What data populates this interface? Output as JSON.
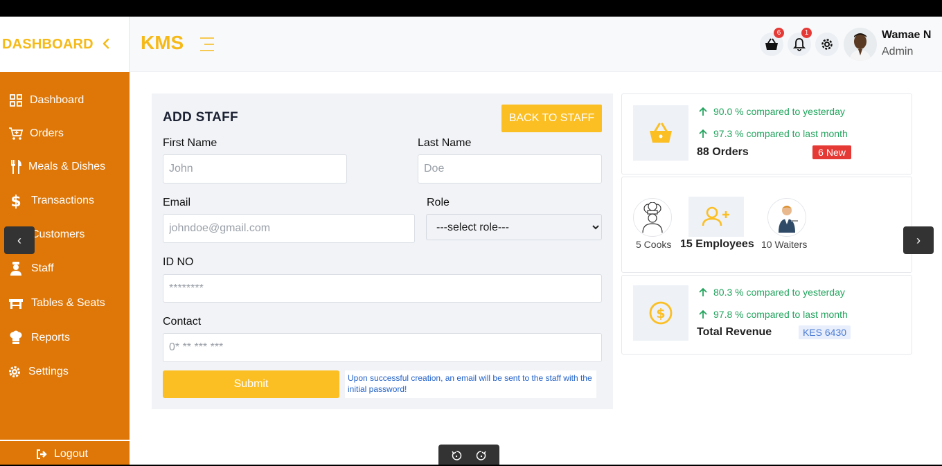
{
  "brand": {
    "title": "DASHBOARD"
  },
  "header": {
    "app_name": "KMS",
    "cart_badge": "6",
    "notif_badge": "1",
    "user_name": "Wamae N",
    "user_role": "Admin"
  },
  "sidebar": {
    "items": [
      {
        "label": "Dashboard",
        "icon": "grid-icon"
      },
      {
        "label": "Orders",
        "icon": "cart-icon"
      },
      {
        "label": "Meals & Dishes",
        "icon": "utensils-icon"
      },
      {
        "label": "Transactions",
        "icon": "dollar-icon"
      },
      {
        "label": "Customers",
        "icon": "users-icon"
      },
      {
        "label": "Staff",
        "icon": "staff-icon"
      },
      {
        "label": "Tables & Seats",
        "icon": "table-icon"
      },
      {
        "label": "Reports",
        "icon": "chef-hat-icon"
      },
      {
        "label": "Settings",
        "icon": "gear-icon"
      }
    ],
    "logout": "Logout"
  },
  "form": {
    "title": "ADD STAFF",
    "back_label": "BACK TO STAFF",
    "first_name_label": "First Name",
    "first_name_placeholder": "John",
    "last_name_label": "Last Name",
    "last_name_placeholder": "Doe",
    "email_label": "Email",
    "email_placeholder": "johndoe@gmail.com",
    "role_label": "Role",
    "role_selected": "---select role---",
    "id_label": "ID NO",
    "id_placeholder": "********",
    "contact_label": "Contact",
    "contact_placeholder": "0* ** *** ***",
    "submit_label": "Submit",
    "note": "Upon successful creation, an email will be sent to the staff with the initial password!"
  },
  "stats": {
    "orders": {
      "daily": "90.0 % compared to yesterday",
      "monthly": "97.3 % compared to last month",
      "total": "88 Orders",
      "new_badge": "6 New"
    },
    "employees": {
      "cooks": "5 Cooks",
      "total": "15 Employees",
      "waiters": "10 Waiters"
    },
    "revenue": {
      "daily": "80.3 % compared to yesterday",
      "monthly": "97.8 % compared to last month",
      "label": "Total Revenue",
      "amount": "KES 6430"
    }
  },
  "colors": {
    "accent": "#fbbf24",
    "sidebar": "#de7707",
    "positive": "#22a45d",
    "danger": "#e53935"
  }
}
